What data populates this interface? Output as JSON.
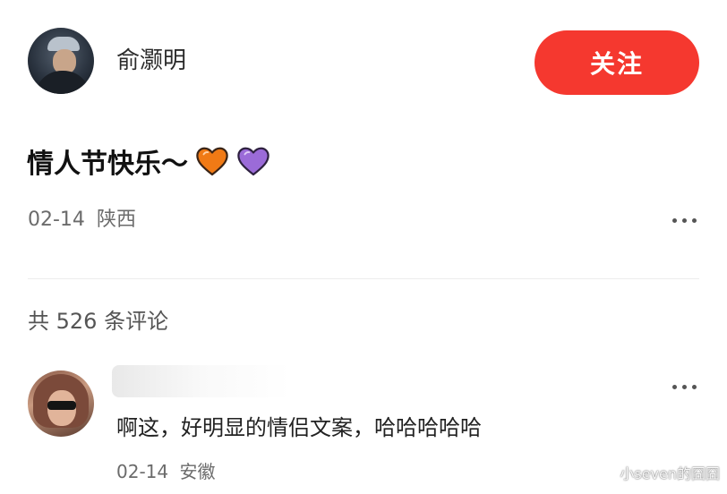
{
  "post": {
    "author_name": "俞灏明",
    "follow_label": "关注",
    "text": "情人节快乐～",
    "date": "02-14",
    "location": "陕西",
    "hearts": [
      {
        "icon": "orange-heart-icon",
        "color": "#f07a15"
      },
      {
        "icon": "purple-heart-icon",
        "color": "#9b6bd8"
      }
    ]
  },
  "comments": {
    "count_label": "共 526 条评论",
    "items": [
      {
        "text": "啊这，好明显的情侣文案，哈哈哈哈哈",
        "date": "02-14",
        "location": "安徽"
      }
    ]
  },
  "colors": {
    "accent": "#f5382f"
  },
  "watermark": "小seven的囧囧"
}
